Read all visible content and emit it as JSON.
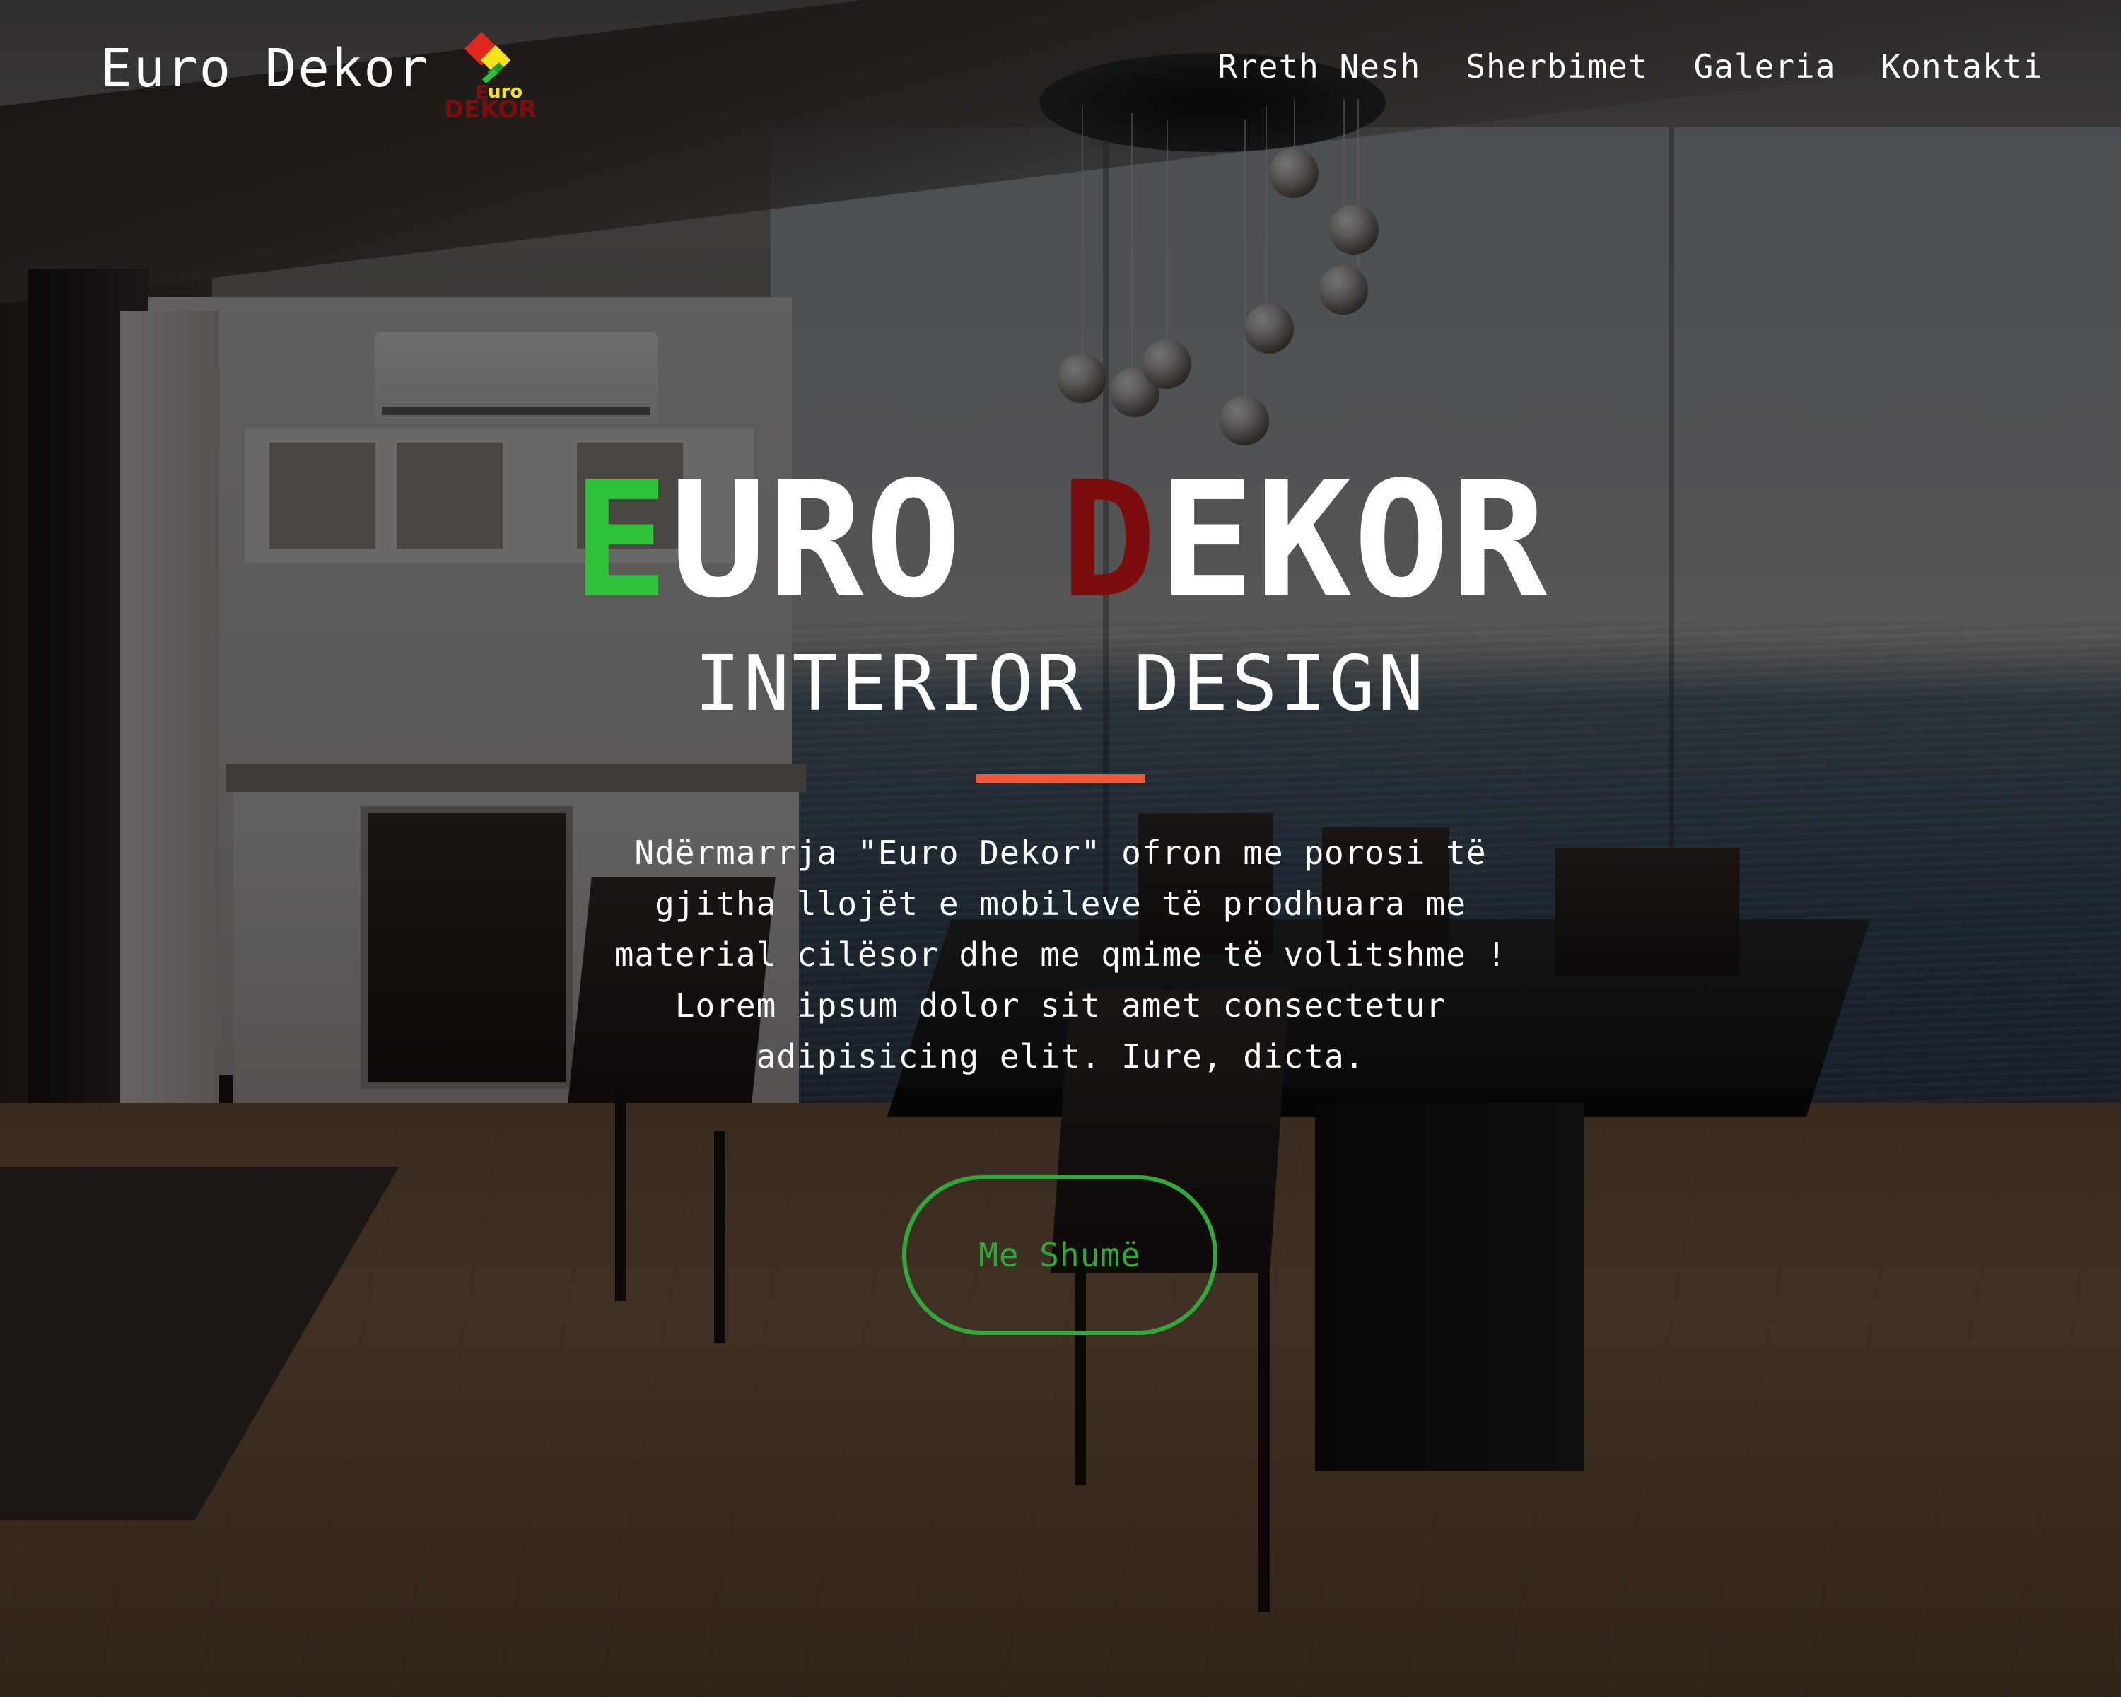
{
  "header": {
    "brand": "Euro Dekor",
    "logo": {
      "top_text": "uro",
      "bottom_text": "DEKOR"
    },
    "nav": [
      {
        "label": "Rreth Nesh"
      },
      {
        "label": "Sherbimet"
      },
      {
        "label": "Galeria"
      },
      {
        "label": "Kontakti"
      }
    ]
  },
  "hero": {
    "title_word1_first": "E",
    "title_word1_rest": "URO",
    "title_word2_first": "D",
    "title_word2_rest": "EKOR",
    "subtitle": "INTERIOR DESIGN",
    "paragraph": "Ndërmarrja \"Euro Dekor\" ofron me porosi të gjitha llojët e mobileve të prodhuara me material cilësor dhe me qmime të volitshme ! Lorem ipsum dolor sit amet consectetur adipisicing elit. Iure, dicta.",
    "cta_label": "Me Shumë"
  },
  "colors": {
    "accent_green": "#2fc23a",
    "accent_dark_red": "#7d0d0d",
    "divider_orange": "#ef5a3a",
    "button_green": "#32a83c"
  },
  "icons": {
    "logo": "euro-dekor-logo-icon"
  }
}
